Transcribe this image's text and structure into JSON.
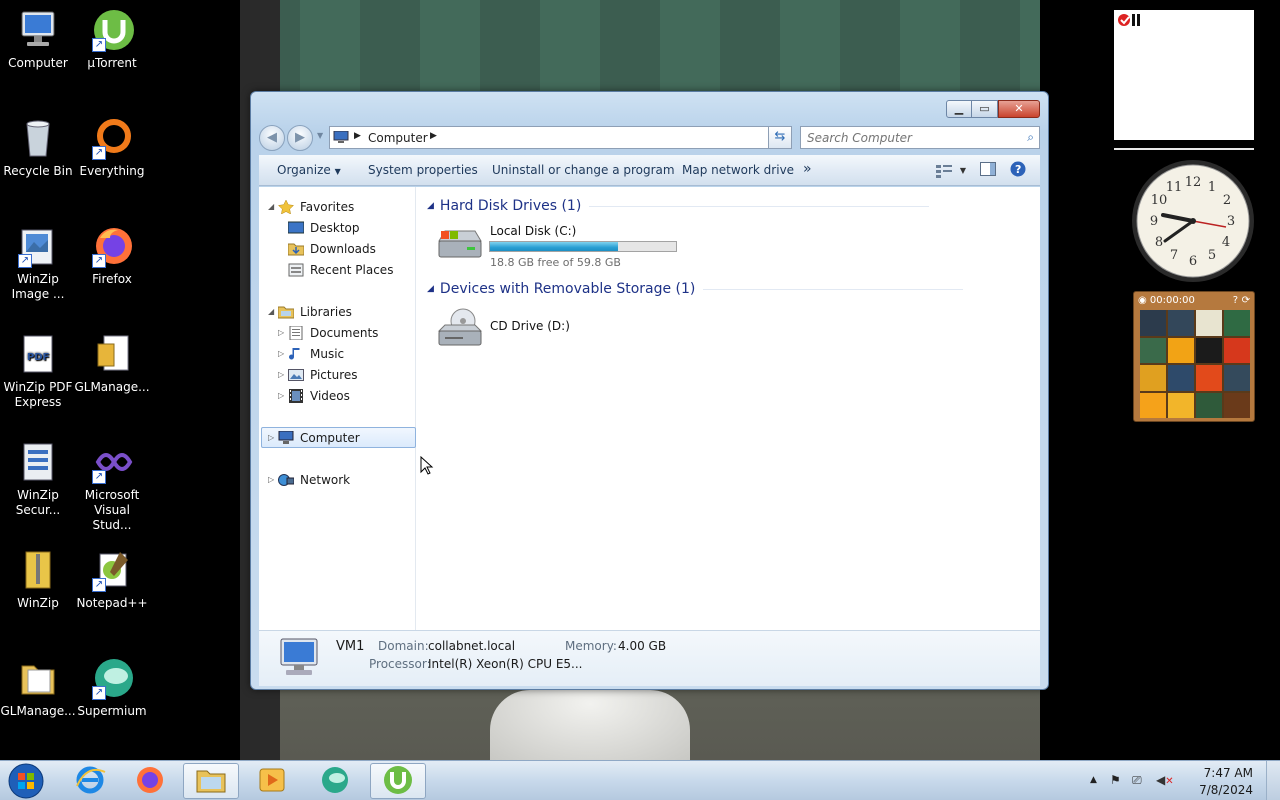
{
  "desktop": {
    "icons": [
      {
        "label": "Computer",
        "icon": "computer-icon"
      },
      {
        "label": "µTorrent",
        "icon": "utorrent-icon"
      },
      {
        "label": "Recycle Bin",
        "icon": "recycle-bin-icon"
      },
      {
        "label": "Everything",
        "icon": "everything-icon"
      },
      {
        "label": "WinZip Image ...",
        "icon": "winzip-image-icon"
      },
      {
        "label": "Firefox",
        "icon": "firefox-icon"
      },
      {
        "label": "WinZip PDF Express",
        "icon": "winzip-pdf-icon"
      },
      {
        "label": "GLManage...",
        "icon": "glmanager-icon"
      },
      {
        "label": "WinZip Secur...",
        "icon": "winzip-secure-icon"
      },
      {
        "label": "Microsoft Visual Stud...",
        "icon": "visual-studio-icon"
      },
      {
        "label": "WinZip",
        "icon": "winzip-icon"
      },
      {
        "label": "Notepad++",
        "icon": "notepadpp-icon"
      },
      {
        "label": "GLManage...",
        "icon": "glmanager-folder-icon"
      },
      {
        "label": "Supermium",
        "icon": "supermium-icon"
      }
    ]
  },
  "explorer": {
    "address": {
      "crumb": "Computer"
    },
    "search": {
      "placeholder": "Search Computer"
    },
    "toolbar": {
      "organize": "Organize",
      "system_properties": "System properties",
      "uninstall": "Uninstall or change a program",
      "map_drive": "Map network drive",
      "more": "»"
    },
    "nav": {
      "favorites": "Favorites",
      "desktop": "Desktop",
      "downloads": "Downloads",
      "recent_places": "Recent Places",
      "libraries": "Libraries",
      "documents": "Documents",
      "music": "Music",
      "pictures": "Pictures",
      "videos": "Videos",
      "computer": "Computer",
      "network": "Network"
    },
    "groups": {
      "hdd_title": "Hard Disk Drives (1)",
      "removable_title": "Devices with Removable Storage (1)"
    },
    "drives": {
      "local_name": "Local Disk (C:)",
      "local_free": "18.8 GB free of 59.8 GB",
      "local_used_fraction": 0.686,
      "cd_name": "CD Drive (D:)"
    },
    "details": {
      "name": "VM1",
      "domain_label": "Domain:",
      "domain_value": "collabnet.local",
      "memory_label": "Memory:",
      "memory_value": "4.00 GB",
      "processor_label": "Processor:",
      "processor_value": "Intel(R) Xeon(R) CPU E5..."
    }
  },
  "gadgets": {
    "puzzle_timer": "00:00:00"
  },
  "taskbar": {
    "time": "7:47 AM",
    "date": "7/8/2024"
  },
  "colors": {
    "accent": "#1e3287",
    "progress": "#2a9fd3"
  }
}
